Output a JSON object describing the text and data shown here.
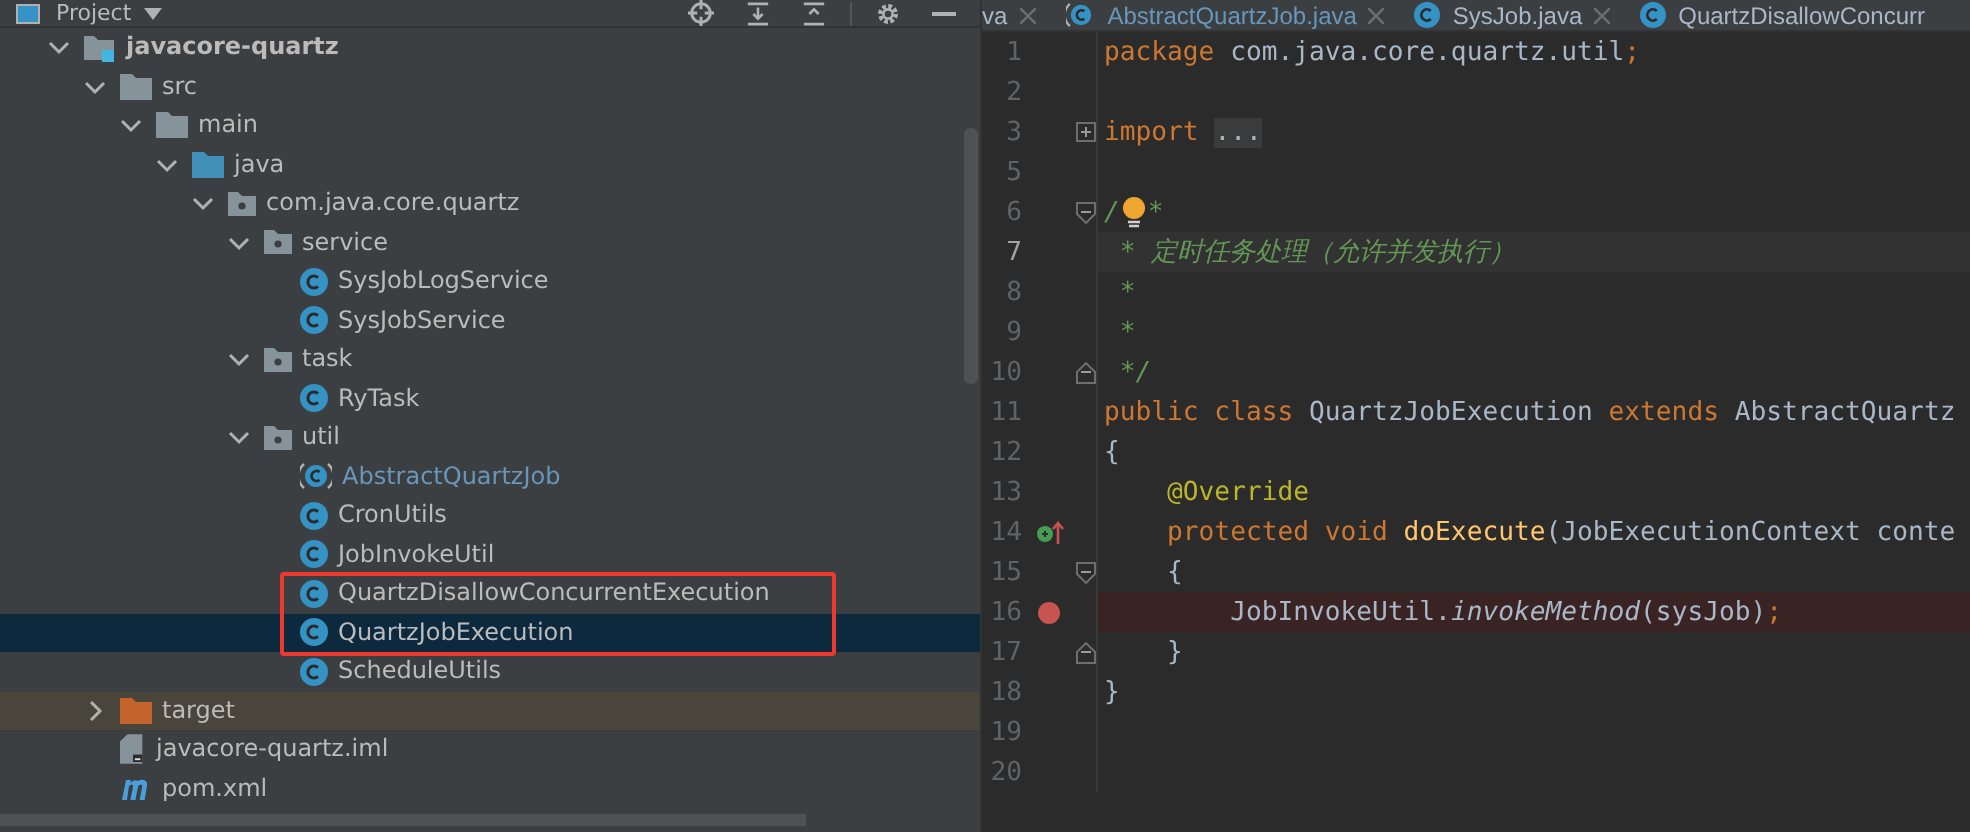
{
  "project_panel": {
    "title": "Project",
    "tree": [
      {
        "label": "javacore-quartz",
        "kind": "module",
        "expanded": true,
        "children": [
          {
            "label": "src",
            "kind": "folder",
            "expanded": true,
            "children": [
              {
                "label": "main",
                "kind": "folder",
                "expanded": true,
                "children": [
                  {
                    "label": "java",
                    "kind": "source-folder",
                    "expanded": true,
                    "children": [
                      {
                        "label": "com.java.core.quartz",
                        "kind": "package",
                        "expanded": true,
                        "children": [
                          {
                            "label": "service",
                            "kind": "package",
                            "expanded": true,
                            "children": [
                              {
                                "label": "SysJobLogService",
                                "kind": "class",
                                "selected": false,
                                "modified": false,
                                "outlined": false
                              },
                              {
                                "label": "SysJobService",
                                "kind": "class",
                                "selected": false,
                                "modified": false,
                                "outlined": false
                              }
                            ]
                          },
                          {
                            "label": "task",
                            "kind": "package",
                            "expanded": true,
                            "children": [
                              {
                                "label": "RyTask",
                                "kind": "class",
                                "selected": false,
                                "modified": false,
                                "outlined": false
                              }
                            ]
                          },
                          {
                            "label": "util",
                            "kind": "package",
                            "expanded": true,
                            "children": [
                              {
                                "label": "AbstractQuartzJob",
                                "kind": "abstract-class",
                                "selected": false,
                                "modified": true,
                                "outlined": false
                              },
                              {
                                "label": "CronUtils",
                                "kind": "class",
                                "selected": false,
                                "modified": false,
                                "outlined": false
                              },
                              {
                                "label": "JobInvokeUtil",
                                "kind": "class",
                                "selected": false,
                                "modified": false,
                                "outlined": false
                              },
                              {
                                "label": "QuartzDisallowConcurrentExecution",
                                "kind": "class",
                                "selected": false,
                                "modified": false,
                                "outlined": true
                              },
                              {
                                "label": "QuartzJobExecution",
                                "kind": "class",
                                "selected": true,
                                "modified": false,
                                "outlined": true
                              },
                              {
                                "label": "ScheduleUtils",
                                "kind": "class",
                                "selected": false,
                                "modified": false,
                                "outlined": false
                              }
                            ]
                          }
                        ]
                      }
                    ]
                  }
                ]
              }
            ]
          },
          {
            "label": "target",
            "kind": "excluded-folder",
            "expanded": false
          },
          {
            "label": "javacore-quartz.iml",
            "kind": "iml-file"
          },
          {
            "label": "pom.xml",
            "kind": "maven-file"
          }
        ]
      }
    ]
  },
  "editor": {
    "tabs": [
      {
        "label": "va",
        "kind": "plain",
        "selected": false,
        "modified": false
      },
      {
        "label": "AbstractQuartzJob.java",
        "kind": "abstract-class",
        "selected": false,
        "modified": true
      },
      {
        "label": "SysJob.java",
        "kind": "class",
        "selected": false,
        "modified": false
      },
      {
        "label": "QuartzDisallowConcurr",
        "kind": "class",
        "selected": false,
        "modified": false
      }
    ],
    "lines": [
      {
        "number": "1",
        "tokens": [
          {
            "text": "package",
            "kind": "keyword"
          },
          {
            "text": " com.java.core.quartz.util",
            "kind": "plain"
          },
          {
            "text": ";",
            "kind": "keyword"
          }
        ]
      },
      {
        "number": "2"
      },
      {
        "number": "3",
        "fold_start": true,
        "collapsed": true,
        "tokens": [
          {
            "text": "import ",
            "kind": "keyword"
          },
          {
            "text": "...",
            "kind": "folded"
          }
        ]
      },
      {
        "number": "5"
      },
      {
        "number": "6",
        "fold_start": true,
        "collapsed": false,
        "bulb": true,
        "tokens": [
          {
            "text": "/",
            "kind": "comment"
          },
          {
            "text": "*",
            "kind": "comment"
          }
        ]
      },
      {
        "number": "7",
        "current": true,
        "tokens": [
          {
            "text": " * 定时任务处理（允许并发执行）",
            "kind": "comment"
          }
        ]
      },
      {
        "number": "8",
        "tokens": [
          {
            "text": " *",
            "kind": "comment"
          }
        ]
      },
      {
        "number": "9",
        "tokens": [
          {
            "text": " *",
            "kind": "comment"
          }
        ]
      },
      {
        "number": "10",
        "fold_end": true,
        "tokens": [
          {
            "text": " */",
            "kind": "comment"
          }
        ]
      },
      {
        "number": "11",
        "tokens": [
          {
            "text": "public class ",
            "kind": "keyword"
          },
          {
            "text": "QuartzJobExecution",
            "kind": "plain"
          },
          {
            "text": " extends ",
            "kind": "keyword"
          },
          {
            "text": "AbstractQuartz",
            "kind": "plain"
          }
        ]
      },
      {
        "number": "12",
        "tokens": [
          {
            "text": "{",
            "kind": "plain"
          }
        ]
      },
      {
        "number": "13",
        "tokens": [
          {
            "text": "    @Override",
            "kind": "annotation"
          }
        ]
      },
      {
        "number": "14",
        "override": true,
        "tokens": [
          {
            "text": "    protected void ",
            "kind": "keyword"
          },
          {
            "text": "doExecute",
            "kind": "method"
          },
          {
            "text": "(JobExecutionContext conte",
            "kind": "plain"
          }
        ]
      },
      {
        "number": "15",
        "fold_start": true,
        "collapsed": false,
        "tokens": [
          {
            "text": "    {",
            "kind": "plain"
          }
        ]
      },
      {
        "number": "16",
        "breakpoint": true,
        "tokens": [
          {
            "text": "        JobInvokeUtil.",
            "kind": "plain"
          },
          {
            "text": "invokeMethod",
            "kind": "static-call"
          },
          {
            "text": "(sysJob)",
            "kind": "plain"
          },
          {
            "text": ";",
            "kind": "keyword"
          }
        ]
      },
      {
        "number": "17",
        "fold_end": true,
        "tokens": [
          {
            "text": "    }",
            "kind": "plain"
          }
        ]
      },
      {
        "number": "18",
        "tokens": [
          {
            "text": "}",
            "kind": "plain"
          }
        ]
      },
      {
        "number": "19"
      },
      {
        "number": "20"
      }
    ]
  }
}
